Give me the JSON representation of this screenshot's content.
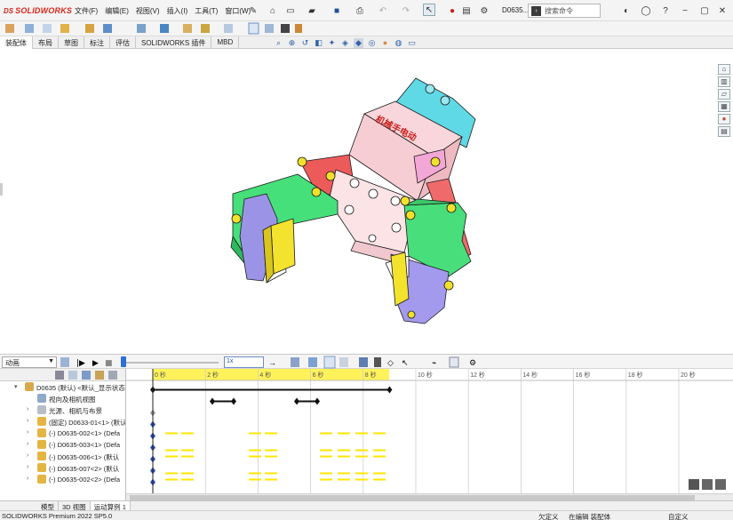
{
  "app": {
    "brand_ds": "DS",
    "brand_name": "SOLIDWORKS"
  },
  "menu": {
    "items": [
      "文件(F)",
      "编辑(E)",
      "视图(V)",
      "插入(I)",
      "工具(T)",
      "窗口(W)"
    ]
  },
  "document": {
    "name": "D0635..."
  },
  "search": {
    "placeholder": "搜索命令"
  },
  "tabs": {
    "items": [
      "装配体",
      "布局",
      "草图",
      "标注",
      "评估",
      "SOLIDWORKS 插件",
      "MBD"
    ],
    "active_index": 0
  },
  "viewport": {
    "part_label": "机械手电动"
  },
  "motion": {
    "study_type": "动画",
    "speed": "1x",
    "time_labels": [
      "0 秒",
      "2 秒",
      "4 秒",
      "6 秒",
      "8 秒",
      "10 秒",
      "12 秒",
      "14 秒",
      "16 秒",
      "18 秒",
      "20 秒"
    ],
    "tree": [
      {
        "label": "D0635 (默认) <默认_显示状态",
        "level": 0,
        "icon": "assembly-icon"
      },
      {
        "label": "视向及相机视图",
        "level": 1,
        "icon": "camera-icon"
      },
      {
        "label": "光源、相机与布景",
        "level": 1,
        "icon": "lights-icon"
      },
      {
        "label": "(固定) D0633-01<1> (默认",
        "level": 1,
        "icon": "part-icon"
      },
      {
        "label": "(-) D0635-002<1> (Defa",
        "level": 1,
        "icon": "part-icon"
      },
      {
        "label": "(-) D0635-003<1> (Defa",
        "level": 1,
        "icon": "part-icon"
      },
      {
        "label": "(-) D0635-006<1> (默认",
        "level": 1,
        "icon": "part-icon"
      },
      {
        "label": "(-) D0635-007<2> (默认",
        "level": 1,
        "icon": "part-icon"
      },
      {
        "label": "(-) D0635-002<2> (Defa",
        "level": 1,
        "icon": "part-icon"
      }
    ]
  },
  "bottom_tabs": {
    "items": [
      "模型",
      "3D 视图",
      "运动算例 1"
    ],
    "active_index": 2
  },
  "status": {
    "product": "SOLIDWORKS Premium 2022 SP5.0",
    "state1": "欠定义",
    "state2": "在编辑 装配体",
    "state3": "自定义"
  },
  "colors": {
    "accent_red": "#d9261c",
    "timeline_key_yellow": "#ffe600",
    "timeline_blue": "#2c4fb8"
  }
}
